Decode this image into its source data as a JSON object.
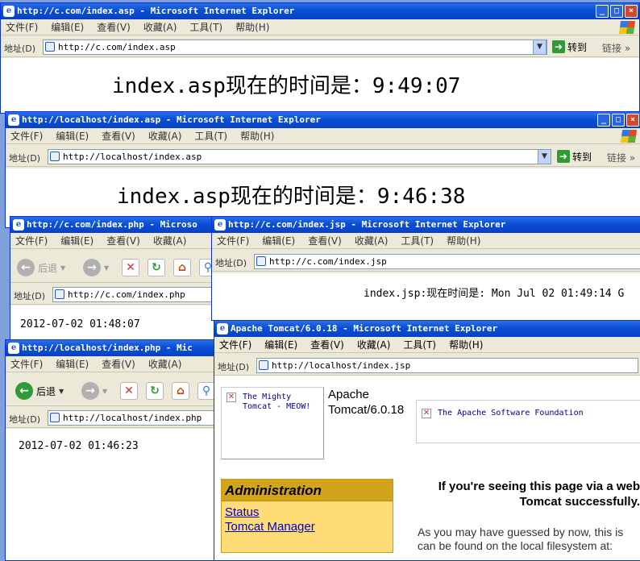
{
  "menu": [
    "文件(F)",
    "编辑(E)",
    "查看(V)",
    "收藏(A)",
    "工具(T)",
    "帮助(H)"
  ],
  "address_label": "地址(D)",
  "go_label": "转到",
  "links_label": "链接",
  "back_label": "后退",
  "w1": {
    "title": "http://c.com/index.asp - Microsoft Internet Explorer",
    "url": "http://c.com/index.asp",
    "content": "index.asp现在的时间是：9:49:07"
  },
  "w2": {
    "title": "http://localhost/index.asp - Microsoft Internet Explorer",
    "url": "http://localhost/index.asp",
    "content": "index.asp现在的时间是：9:46:38"
  },
  "w3": {
    "title": "http://c.com/index.php - Microso",
    "url": "http://c.com/index.php",
    "content": "2012-07-02 01:48:07"
  },
  "w4": {
    "title": "http://localhost/index.php - Mic",
    "url": "http://localhost/index.php",
    "content": "2012-07-02 01:46:23"
  },
  "w5": {
    "title": "http://c.com/index.jsp - Microsoft Internet Explorer",
    "url": "http://c.com/index.jsp",
    "content": "index.jsp:现在时间是: Mon Jul 02 01:49:14 G"
  },
  "w6": {
    "title": "Apache Tomcat/6.0.18 - Microsoft Internet Explorer",
    "url": "http://localhost/index.jsp",
    "img1_alt": "The Mighty Tomcat - MEOW!",
    "heading": "Apache Tomcat/6.0.18",
    "img2_alt": "The Apache Software Foundation",
    "admin_title": "Administration",
    "admin_links": [
      "Status",
      "Tomcat Manager"
    ],
    "success_text": "If you're seeing this page via a web Tomcat successfully.",
    "guess_text": "As you may have guessed by now, this is can be found on the local filesystem at:"
  },
  "colors": {
    "titlebar": "#0a4fd4",
    "admin_bg": "#ffdc75",
    "admin_header": "#d2a41c",
    "link": "#0000cc"
  }
}
